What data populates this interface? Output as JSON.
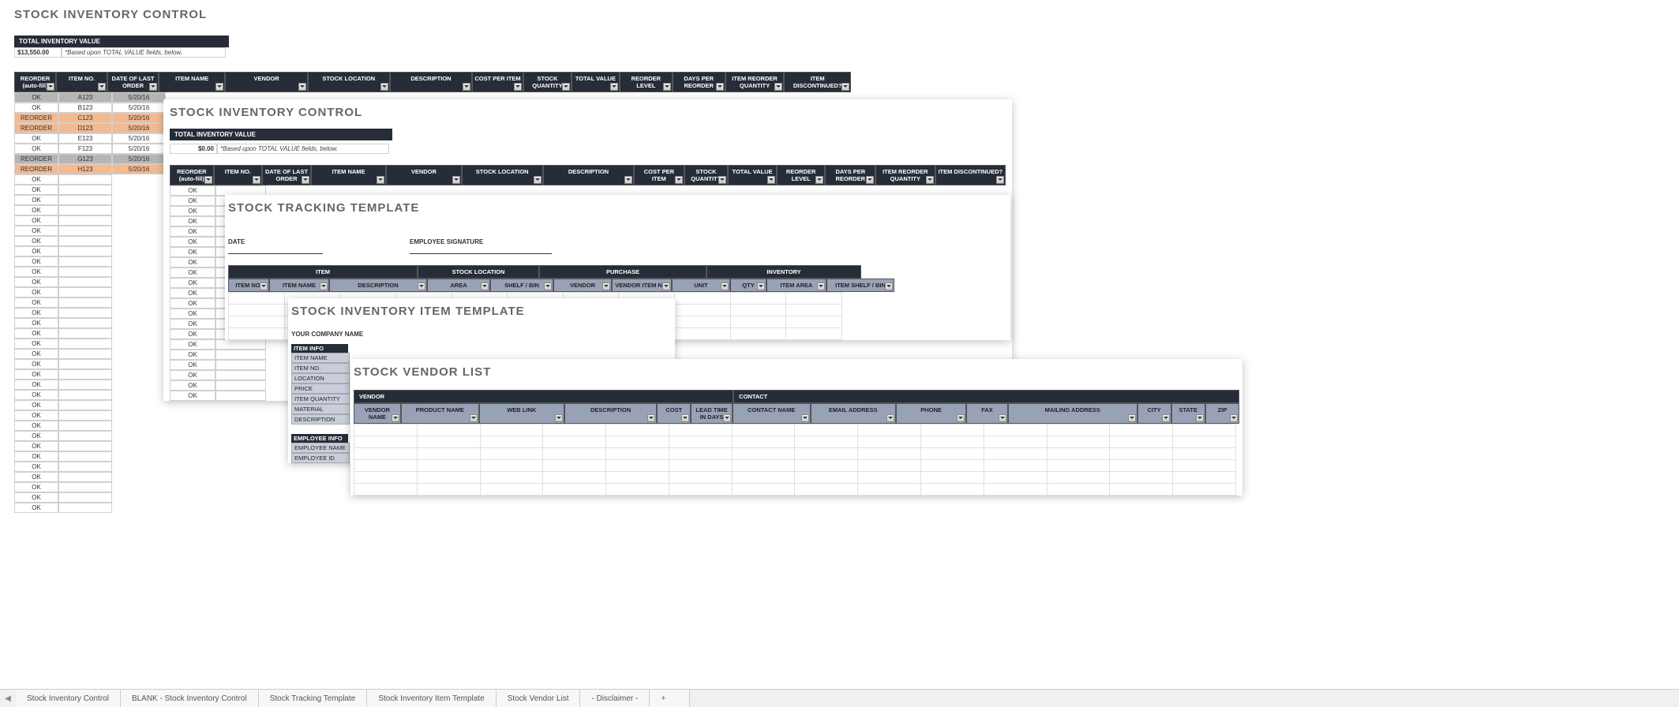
{
  "panel1": {
    "title": "STOCK INVENTORY CONTROL",
    "tiv_label": "TOTAL INVENTORY VALUE",
    "tiv_value": "$13,550.00",
    "tiv_note": "*Based upon TOTAL VALUE fields, below.",
    "headers": [
      "REORDER (auto-fill)",
      "ITEM NO.",
      "DATE OF LAST ORDER",
      "ITEM NAME",
      "VENDOR",
      "STOCK LOCATION",
      "DESCRIPTION",
      "COST PER ITEM",
      "STOCK QUANTITY",
      "TOTAL VALUE",
      "REORDER LEVEL",
      "DAYS PER REORDER",
      "ITEM REORDER QUANTITY",
      "ITEM DISCONTINUED?"
    ],
    "rows": [
      {
        "status": "OK",
        "item": "A123",
        "date": "5/20/16",
        "cls": "ok-gray"
      },
      {
        "status": "OK",
        "item": "B123",
        "date": "5/20/16",
        "cls": ""
      },
      {
        "status": "REORDER",
        "item": "C123",
        "date": "5/20/16",
        "cls": "reorder-orange"
      },
      {
        "status": "REORDER",
        "item": "D123",
        "date": "5/20/16",
        "cls": "reorder-orange"
      },
      {
        "status": "OK",
        "item": "E123",
        "date": "5/20/16",
        "cls": ""
      },
      {
        "status": "OK",
        "item": "F123",
        "date": "5/20/16",
        "cls": ""
      },
      {
        "status": "REORDER",
        "item": "G123",
        "date": "5/20/16",
        "cls": "ok-gray"
      },
      {
        "status": "REORDER",
        "item": "H123",
        "date": "5/20/16",
        "cls": "reorder-orange"
      }
    ],
    "empty_ok_count": 33
  },
  "panel2": {
    "title": "STOCK INVENTORY CONTROL",
    "tiv_label": "TOTAL INVENTORY VALUE",
    "tiv_value": "$0.00",
    "tiv_note": "*Based upon TOTAL VALUE fields, below.",
    "headers": [
      "REORDER (auto-fill)",
      "ITEM NO.",
      "DATE OF LAST ORDER",
      "ITEM NAME",
      "VENDOR",
      "STOCK LOCATION",
      "DESCRIPTION",
      "COST PER ITEM",
      "STOCK QUANTITY",
      "TOTAL VALUE",
      "REORDER LEVEL",
      "DAYS PER REORDER",
      "ITEM REORDER QUANTITY",
      "ITEM DISCONTINUED?"
    ],
    "ok_rows": 21
  },
  "panel3": {
    "title": "STOCK TRACKING TEMPLATE",
    "date_label": "DATE",
    "sig_label": "EMPLOYEE SIGNATURE",
    "top_headers": [
      "ITEM",
      "STOCK LOCATION",
      "PURCHASE",
      "INVENTORY"
    ],
    "sub_headers": [
      "ITEM NO.",
      "ITEM NAME",
      "DESCRIPTION",
      "AREA",
      "SHELF / BIN",
      "VENDOR",
      "VENDOR ITEM NO.",
      "UNIT",
      "QTY",
      "ITEM AREA",
      "ITEM SHELF / BIN"
    ]
  },
  "panel4": {
    "title": "STOCK INVENTORY ITEM TEMPLATE",
    "company": "YOUR COMPANY NAME",
    "section1_label": "ITEM INFO",
    "item_fields": [
      "ITEM NAME",
      "ITEM NO.",
      "LOCATION",
      "PRICE",
      "ITEM QUANTITY",
      "MATERIAL",
      "DESCRIPTION"
    ],
    "section2_label": "EMPLOYEE INFO",
    "emp_fields": [
      "EMPLOYEE NAME",
      "EMPLOYEE ID"
    ]
  },
  "panel5": {
    "title": "STOCK VENDOR LIST",
    "top_headers": [
      "VENDOR",
      "CONTACT"
    ],
    "sub_headers": [
      "VENDOR NAME",
      "PRODUCT NAME",
      "WEB LINK",
      "DESCRIPTION",
      "COST",
      "LEAD TIME IN DAYS",
      "CONTACT NAME",
      "EMAIL ADDRESS",
      "PHONE",
      "FAX",
      "MAILING ADDRESS",
      "CITY",
      "STATE",
      "ZIP"
    ]
  },
  "tabs": {
    "items": [
      "Stock Inventory Control",
      "BLANK - Stock Inventory Control",
      "Stock Tracking Template",
      "Stock Inventory Item Template",
      "Stock Vendor List",
      "- Disclaimer -"
    ],
    "active_index": -1
  }
}
